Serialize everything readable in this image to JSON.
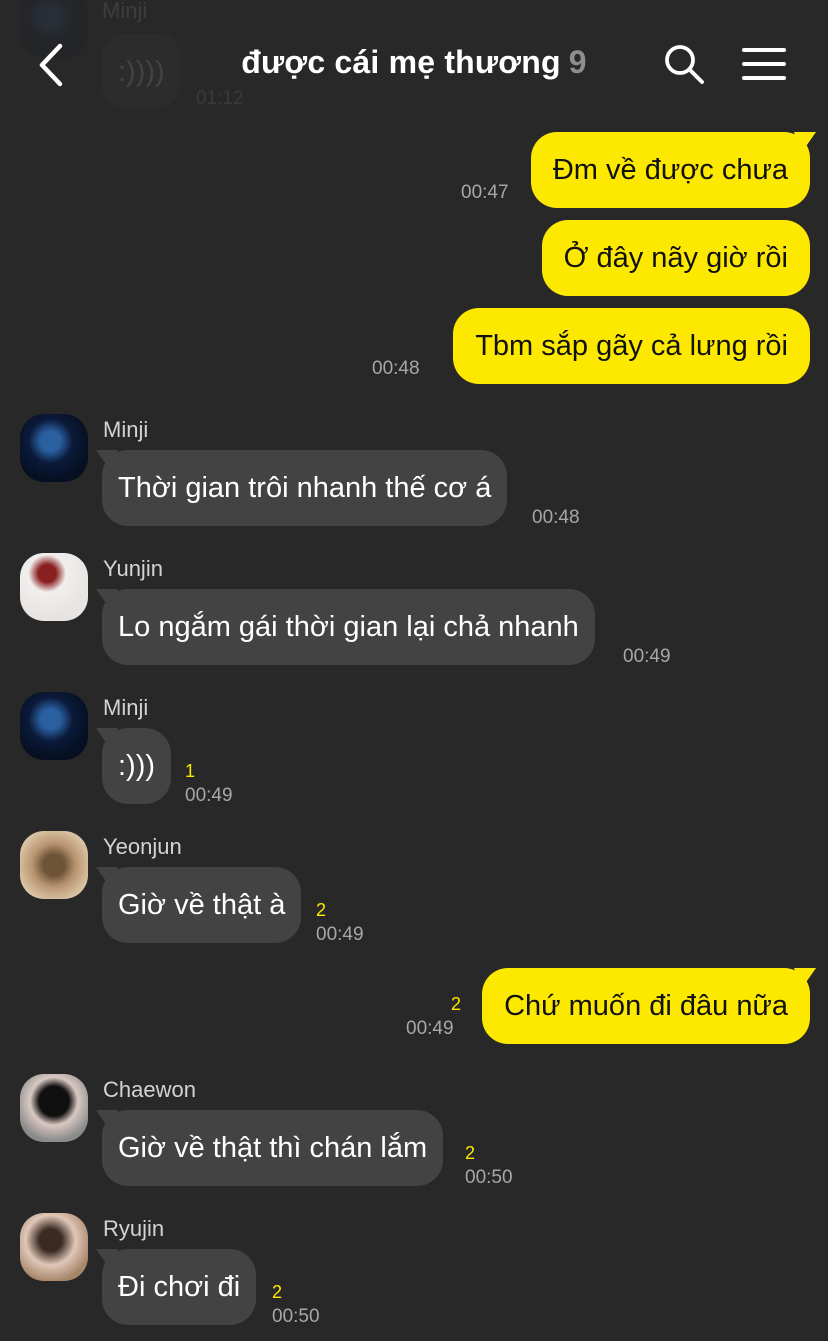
{
  "header": {
    "title": "được cái mẹ thương",
    "member_count": "9"
  },
  "ghost_message": {
    "sender": "Minji",
    "text": ":))))",
    "time": "01:12"
  },
  "messages": [
    {
      "from": "me",
      "text": "Đm về được chưa",
      "time": "00:47"
    },
    {
      "from": "me",
      "text": "Ở đây nãy giờ rồi"
    },
    {
      "from": "me",
      "text": "Tbm sắp gãy cả lưng rồi",
      "time": "00:48"
    },
    {
      "from": "other",
      "sender": "Minji",
      "text": "Thời gian trôi nhanh thế cơ á",
      "time": "00:48"
    },
    {
      "from": "other",
      "sender": "Yunjin",
      "text": "Lo ngắm gái thời gian lại chả nhanh",
      "time": "00:49"
    },
    {
      "from": "other",
      "sender": "Minji",
      "text": ":)))",
      "unread": "1",
      "time": "00:49"
    },
    {
      "from": "other",
      "sender": "Yeonjun",
      "text": "Giờ về thật à",
      "unread": "2",
      "time": "00:49"
    },
    {
      "from": "me",
      "text": "Chứ muốn đi đâu nữa",
      "unread": "2",
      "time": "00:49"
    },
    {
      "from": "other",
      "sender": "Chaewon",
      "text": "Giờ về thật thì chán lắm",
      "unread": "2",
      "time": "00:50"
    },
    {
      "from": "other",
      "sender": "Ryujin",
      "text": "Đi chơi đi",
      "unread": "2",
      "time": "00:50"
    }
  ],
  "colors": {
    "background": "#282828",
    "my_bubble": "#fde900",
    "other_bubble": "#434343",
    "unread": "#fde900"
  },
  "icons": [
    "back-icon",
    "search-icon",
    "menu-icon"
  ]
}
